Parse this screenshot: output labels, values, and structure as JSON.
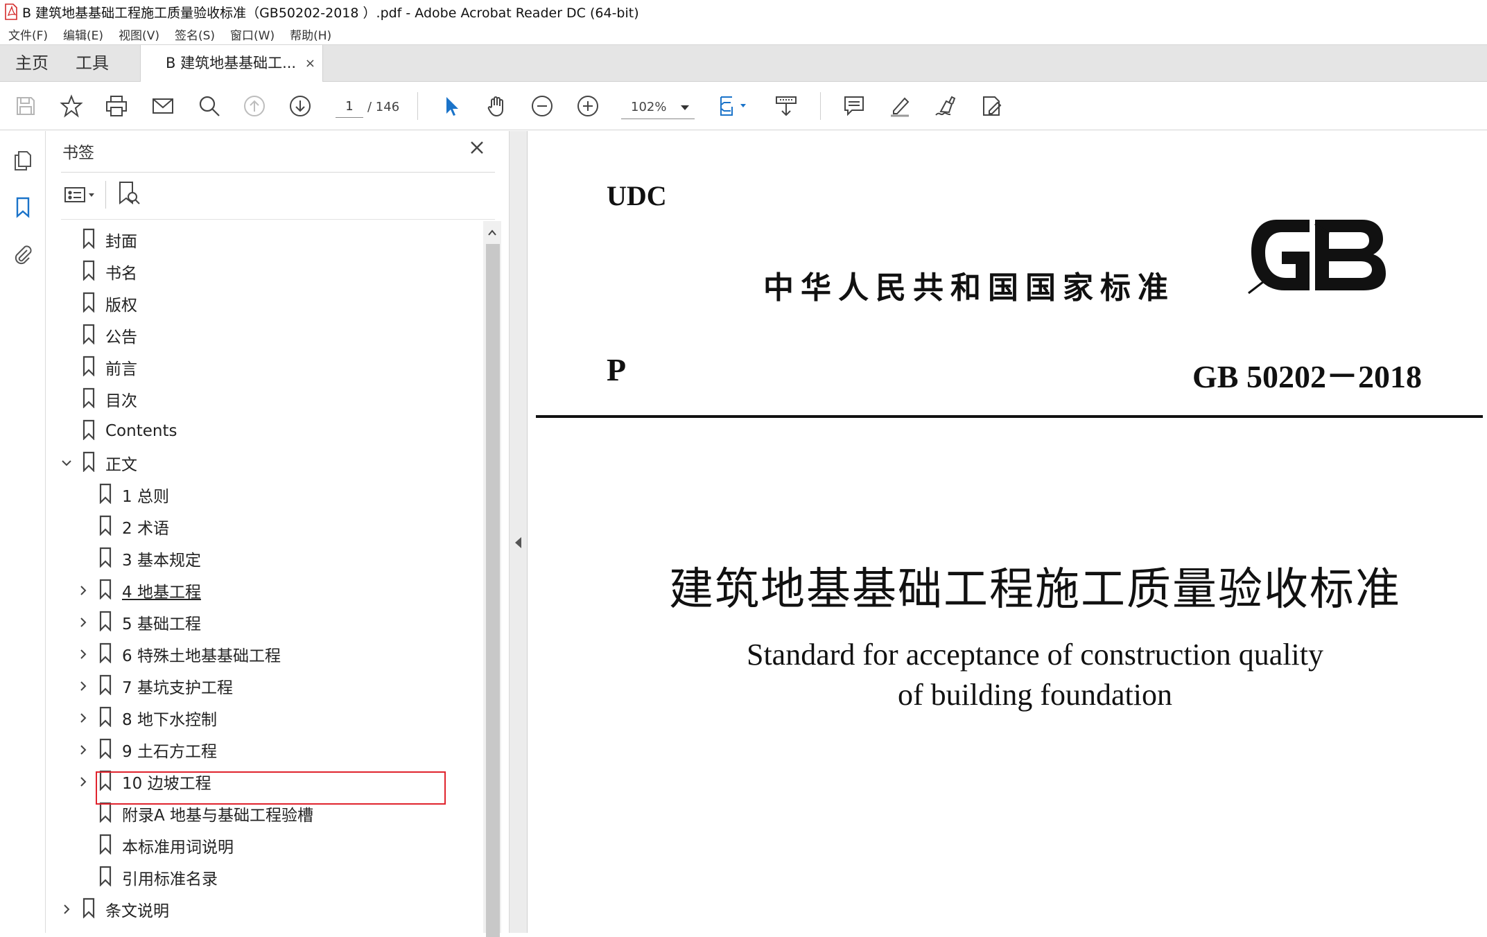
{
  "window": {
    "title": "B 建筑地基基础工程施工质量验收标准（GB50202-2018 ）.pdf - Adobe Acrobat Reader DC (64-bit)"
  },
  "menu": [
    "文件(F)",
    "编辑(E)",
    "视图(V)",
    "签名(S)",
    "窗口(W)",
    "帮助(H)"
  ],
  "nav_tabs": {
    "home": "主页",
    "tools": "工具"
  },
  "doc_tab": {
    "label": "B 建筑地基基础工...",
    "close": "×"
  },
  "toolbar": {
    "page_current": "1",
    "page_total": "/ 146",
    "zoom": "102%"
  },
  "bookmarks_panel": {
    "title": "书签",
    "close": "✕",
    "items": [
      {
        "label": "封面",
        "level": 0,
        "chevron": "none"
      },
      {
        "label": "书名",
        "level": 0,
        "chevron": "none"
      },
      {
        "label": "版权",
        "level": 0,
        "chevron": "none"
      },
      {
        "label": "公告",
        "level": 0,
        "chevron": "none"
      },
      {
        "label": "前言",
        "level": 0,
        "chevron": "none"
      },
      {
        "label": "目次",
        "level": 0,
        "chevron": "none"
      },
      {
        "label": "Contents",
        "level": 0,
        "chevron": "none"
      },
      {
        "label": "正文",
        "level": 0,
        "chevron": "expanded"
      },
      {
        "label": "1 总则",
        "level": 1,
        "chevron": "none"
      },
      {
        "label": "2 术语",
        "level": 1,
        "chevron": "none"
      },
      {
        "label": "3 基本规定",
        "level": 1,
        "chevron": "none"
      },
      {
        "label": "4 地基工程",
        "level": 1,
        "chevron": "collapsed",
        "underline": true
      },
      {
        "label": "5 基础工程",
        "level": 1,
        "chevron": "collapsed"
      },
      {
        "label": "6 特殊土地基基础工程",
        "level": 1,
        "chevron": "collapsed",
        "highlighted": true
      },
      {
        "label": "7 基坑支护工程",
        "level": 1,
        "chevron": "collapsed"
      },
      {
        "label": "8 地下水控制",
        "level": 1,
        "chevron": "collapsed"
      },
      {
        "label": "9 土石方工程",
        "level": 1,
        "chevron": "collapsed"
      },
      {
        "label": "10 边坡工程",
        "level": 1,
        "chevron": "collapsed"
      },
      {
        "label": "附录A 地基与基础工程验槽",
        "level": 1,
        "chevron": "none"
      },
      {
        "label": "本标准用词说明",
        "level": 1,
        "chevron": "none"
      },
      {
        "label": "引用标准名录",
        "level": 1,
        "chevron": "none"
      },
      {
        "label": "条文说明",
        "level": 0,
        "chevron": "collapsed"
      }
    ]
  },
  "document": {
    "udc": "UDC",
    "national_standard": "中华人民共和国国家标准",
    "logo": "GB",
    "classification": "P",
    "standard_number": "GB 50202－2018",
    "title_cn": "建筑地基基础工程施工质量验收标准",
    "title_en_line1": "Standard for acceptance of construction quality",
    "title_en_line2": "of building foundation"
  },
  "colors": {
    "accent_blue": "#1a73c9",
    "highlight_red": "#e0232d",
    "pdf_red": "#d32a2a"
  },
  "icons": [
    "pdf-icon",
    "save-icon",
    "star-icon",
    "print-icon",
    "mail-icon",
    "search-icon",
    "page-up-icon",
    "page-down-icon",
    "select-cursor-icon",
    "hand-icon",
    "zoom-out-icon",
    "zoom-in-icon",
    "fit-page-icon",
    "scroll-mode-icon",
    "comment-icon",
    "highlight-icon",
    "sign-icon",
    "edit-icon",
    "pages-icon",
    "bookmark-icon",
    "attachment-icon"
  ]
}
